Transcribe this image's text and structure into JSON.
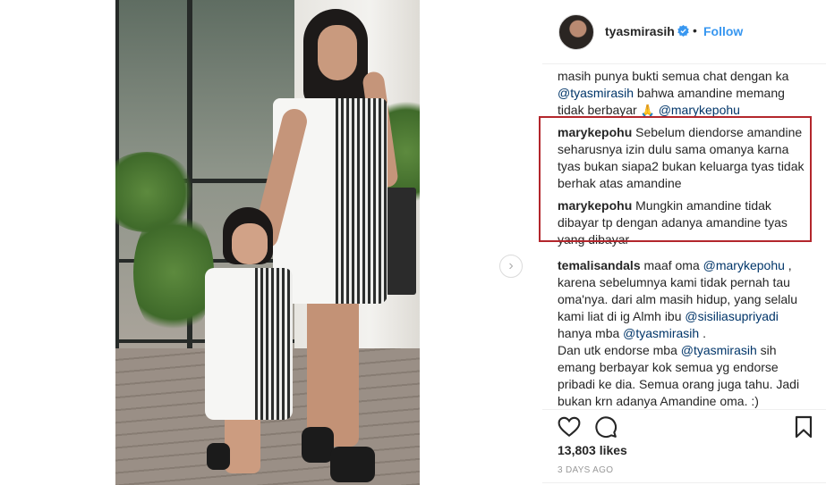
{
  "post": {
    "image_alt": "Mother and daughter in matching half-white, half-striped dresses on a balcony"
  },
  "header": {
    "username": "tyasmirasih",
    "dot": "•",
    "follow_label": "Follow",
    "verified_icon": "verified-badge-icon"
  },
  "comments": [
    {
      "user": "",
      "segments": [
        {
          "text": "masih punya bukti semua chat dengan ka ",
          "mention": false
        },
        {
          "text": "@tyasmirasih",
          "mention": true
        },
        {
          "text": " bahwa amandine memang tidak berbayar ",
          "mention": false
        },
        {
          "text": "🙏",
          "mention": false,
          "emoji": true
        },
        {
          "text": " ",
          "mention": false
        },
        {
          "text": "@marykepohu",
          "mention": true
        }
      ]
    },
    {
      "user": "marykepohu",
      "segments": [
        {
          "text": " Sebelum diendorse amandine seharusnya izin dulu sama omanya karna tyas bukan siapa2 bukan keluarga tyas tidak berhak atas amandine",
          "mention": false
        }
      ]
    },
    {
      "user": "marykepohu",
      "segments": [
        {
          "text": " Mungkin amandine tidak dibayar tp dengan adanya amandine tyas yang dibayar",
          "mention": false
        }
      ]
    },
    {
      "user": "temalisandals",
      "segments": [
        {
          "text": " maaf oma ",
          "mention": false
        },
        {
          "text": "@marykepohu",
          "mention": true
        },
        {
          "text": " , karena sebelumnya kami tidak pernah tau oma'nya. dari alm masih hidup, yang selalu kami liat di ig Almh ibu ",
          "mention": false
        },
        {
          "text": "@sisiliasupriyadi",
          "mention": true
        },
        {
          "text": " hanya mba ",
          "mention": false
        },
        {
          "text": "@tyasmirasih",
          "mention": true
        },
        {
          "text": " .",
          "mention": false
        },
        {
          "text": "\nDan utk endorse mba ",
          "mention": false
        },
        {
          "text": "@tyasmirasih",
          "mention": true
        },
        {
          "text": " sih emang berbayar kok semua yg endorse pribadi ke dia. Semua orang juga tahu. Jadi bukan krn adanya Amandine oma. :)",
          "mention": false
        }
      ]
    }
  ],
  "actions": {
    "like_icon": "heart-icon",
    "comment_icon": "comment-icon",
    "save_icon": "bookmark-icon"
  },
  "likes_label": "13,803 likes",
  "time_label": "3 DAYS AGO",
  "nav": {
    "next_arrow": "›"
  },
  "colors": {
    "accent": "#3897f0",
    "mention": "#003569",
    "highlight_border": "#b3262c",
    "muted": "#999999"
  }
}
